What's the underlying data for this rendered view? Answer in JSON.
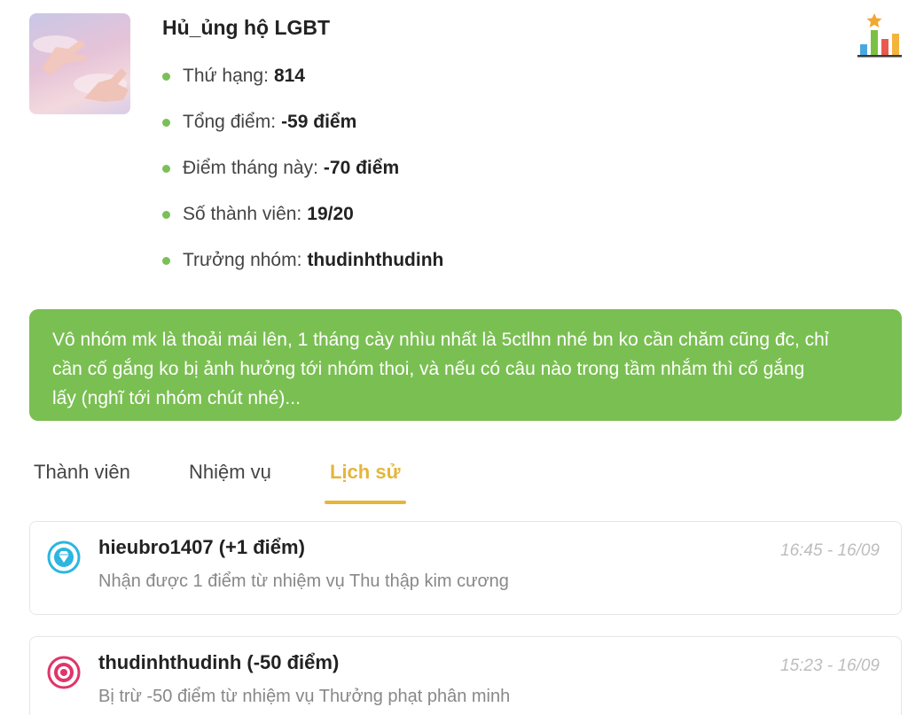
{
  "group": {
    "name": "Hủ_ủng hộ LGBT",
    "stats": [
      {
        "label": "Thứ hạng:",
        "value": "814"
      },
      {
        "label": "Tổng điểm:",
        "value": "-59 điểm"
      },
      {
        "label": "Điểm tháng này:",
        "value": "-70 điểm"
      },
      {
        "label": "Số thành viên:",
        "value": "19/20"
      },
      {
        "label": "Trưởng nhóm:",
        "value": "thudinhthudinh"
      }
    ],
    "description": "Vô nhóm mk là thoải mái lên, 1 tháng cày nhìu nhất là 5ctlhn nhé bn ko cần chăm cũng đc, chỉ cần cố gắng ko bị ảnh hưởng tới nhóm thoi, và nếu có câu nào trong tầm nhắm thì cố gắng lấy (nghĩ tới nhóm chút nhé)...",
    "chart_icon": "bar-chart-star-icon"
  },
  "tabs": [
    {
      "label": "Thành viên",
      "active": false
    },
    {
      "label": "Nhiệm vụ",
      "active": false
    },
    {
      "label": "Lịch sử",
      "active": true
    }
  ],
  "history": [
    {
      "icon": "diamond-icon",
      "title": "hieubro1407 (+1 điểm)",
      "description": "Nhận được 1 điểm từ nhiệm vụ Thu thập kim cương",
      "time": "16:45 - 16/09"
    },
    {
      "icon": "target-icon",
      "title": "thudinhthudinh (-50 điểm)",
      "description": "Bị trừ -50 điểm từ nhiệm vụ Thưởng phạt phân minh",
      "time": "15:23 - 16/09"
    }
  ],
  "colors": {
    "accent_green": "#7abf52",
    "active_tab": "#e5b53c",
    "bullet": "#7bbf5a"
  }
}
